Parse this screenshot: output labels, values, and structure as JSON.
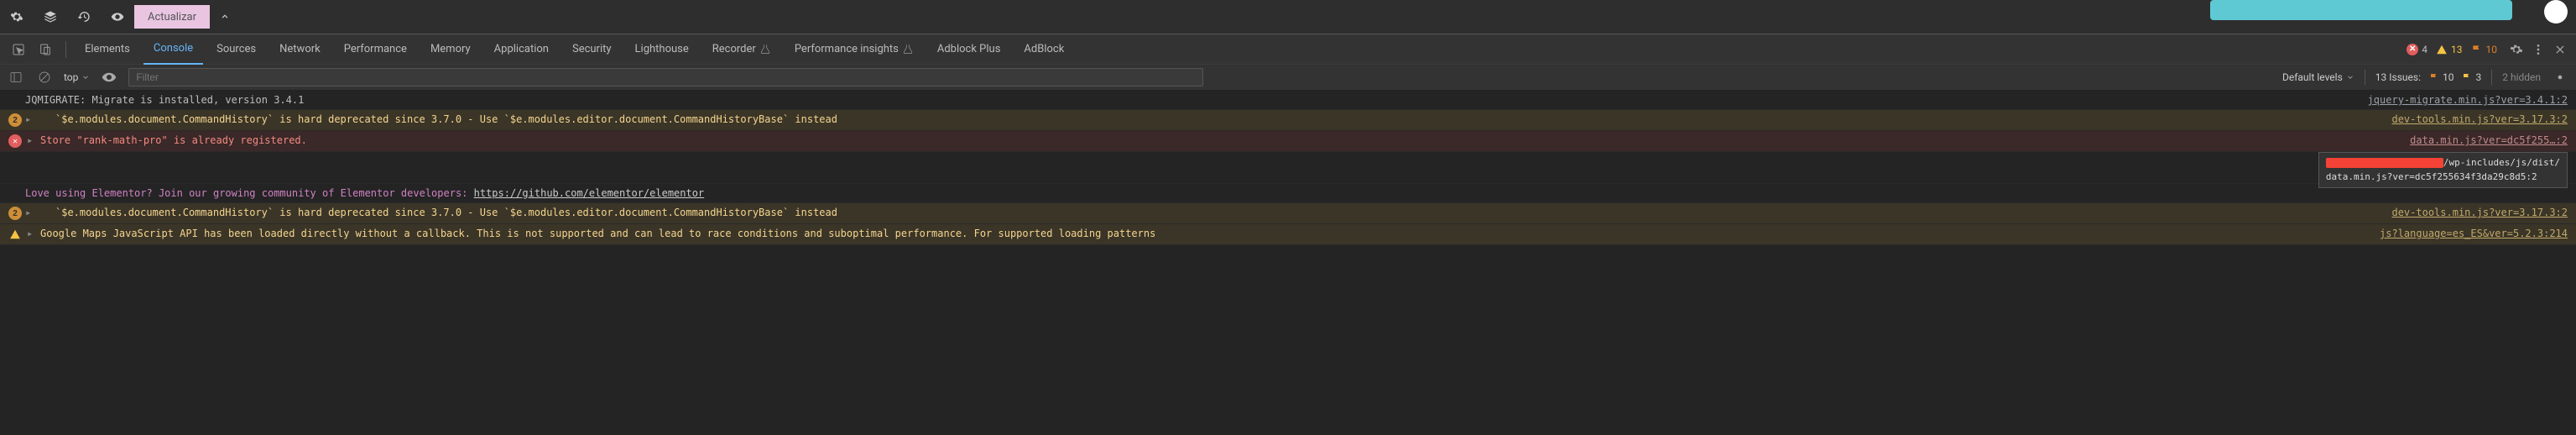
{
  "editor": {
    "update_label": "Actualizar"
  },
  "devtools": {
    "tabs": {
      "elements": "Elements",
      "console": "Console",
      "sources": "Sources",
      "network": "Network",
      "performance": "Performance",
      "memory": "Memory",
      "application": "Application",
      "security": "Security",
      "lighthouse": "Lighthouse",
      "recorder": "Recorder",
      "perf_insights": "Performance insights",
      "adblock_plus": "Adblock Plus",
      "adblock": "AdBlock"
    },
    "counts": {
      "errors": "4",
      "warnings": "13",
      "issues": "10"
    }
  },
  "console_toolbar": {
    "context": "top",
    "filter_placeholder": "Filter",
    "levels": "Default levels",
    "issues_label": "13 Issues:",
    "issue_warn": "10",
    "issue_yellow": "3",
    "hidden": "2 hidden"
  },
  "console": {
    "row0": {
      "msg": "JQMIGRATE: Migrate is installed, version 3.4.1",
      "src": "jquery-migrate.min.js?ver=3.4.1:2"
    },
    "row1": {
      "count": "2",
      "msg": "`$e.modules.document.CommandHistory` is hard deprecated since 3.7.0 - Use `$e.modules.editor.document.CommandHistoryBase` instead",
      "src": "dev-tools.min.js?ver=3.17.3:2"
    },
    "row2": {
      "msg": "Store \"rank-math-pro\" is already registered.",
      "src": "data.min.js?ver=dc5f255…:2"
    },
    "row3": {
      "pre": "Love using Elementor? Join our growing community of Elementor developers: ",
      "link": "https://github.com/elementor/elementor"
    },
    "row4": {
      "count": "2",
      "msg": "`$e.modules.document.CommandHistory` is hard deprecated since 3.7.0 - Use `$e.modules.editor.document.CommandHistoryBase` instead",
      "src": "dev-tools.min.js?ver=3.17.3:2"
    },
    "row5": {
      "msg": "Google Maps JavaScript API has been loaded directly without a callback. This is not supported and can lead to race conditions and suboptimal performance. For supported loading patterns",
      "src": "js?language=es_ES&ver=5.2.3:214"
    }
  },
  "tooltip": {
    "line1_suffix": "/wp-includes/js/dist/",
    "line2": "data.min.js?ver=dc5f255634f3da29c8d5:2"
  }
}
